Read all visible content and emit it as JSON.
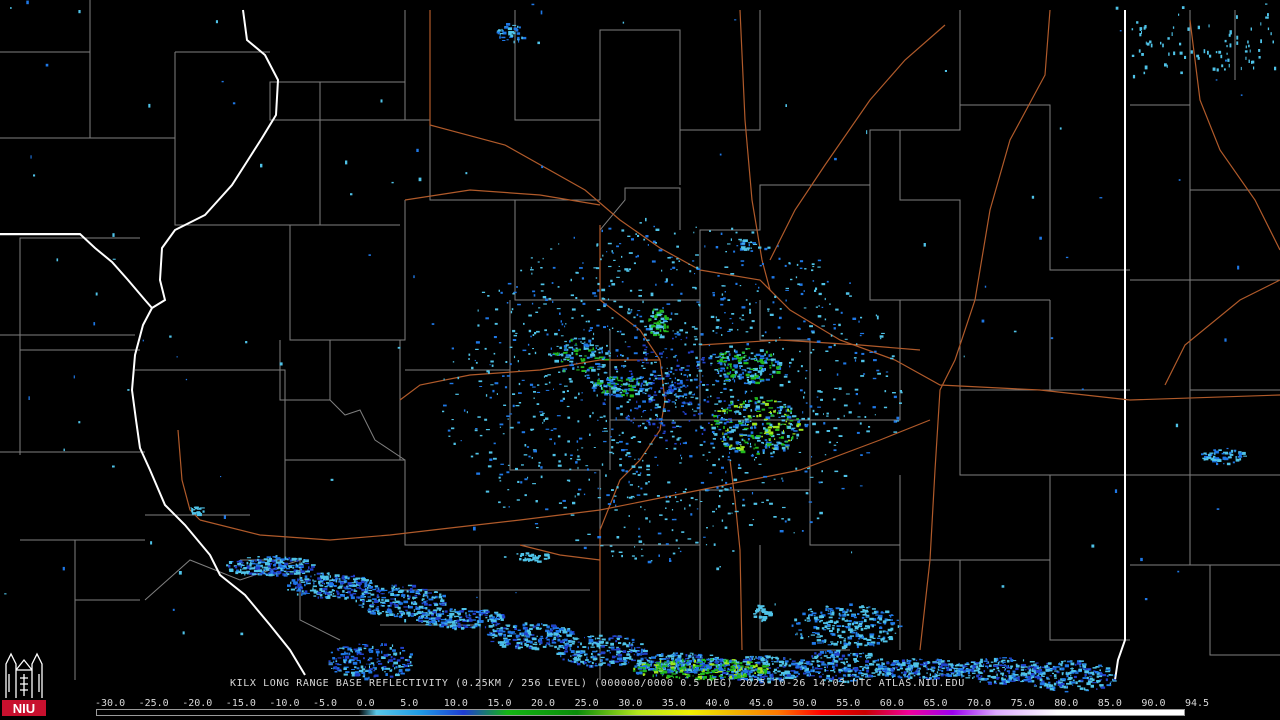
{
  "product": {
    "caption": "KILX LONG RANGE BASE REFLECTIVITY (0.25KM / 256 LEVEL) (000000/0000 0.5 DEG) 2025-10-26 14:02 UTC  ATLAS.NIU.EDU"
  },
  "logo": {
    "text": "NIU",
    "colors": {
      "red": "#c8102e",
      "white": "#ffffff"
    }
  },
  "colorbar": {
    "labels": [
      "-30.0",
      "-25.0",
      "-20.0",
      "-15.0",
      "-10.0",
      "-5.0",
      "0.0",
      "5.0",
      "10.0",
      "15.0",
      "20.0",
      "25.0",
      "30.0",
      "35.0",
      "40.0",
      "45.0",
      "50.0",
      "55.0",
      "60.0",
      "65.0",
      "70.0",
      "75.0",
      "80.0",
      "85.0",
      "90.0",
      "94.5"
    ],
    "stops": [
      {
        "dbz": -30,
        "color": "#000000"
      },
      {
        "dbz": 0,
        "color": "#000000"
      },
      {
        "dbz": 2,
        "color": "#58c8e8"
      },
      {
        "dbz": 7,
        "color": "#1e9be6"
      },
      {
        "dbz": 12,
        "color": "#1e3cd2"
      },
      {
        "dbz": 17,
        "color": "#14b414"
      },
      {
        "dbz": 25,
        "color": "#0a8c0a"
      },
      {
        "dbz": 32,
        "color": "#b4e61e"
      },
      {
        "dbz": 38,
        "color": "#f0f000"
      },
      {
        "dbz": 43,
        "color": "#f0b400"
      },
      {
        "dbz": 48,
        "color": "#ff7800"
      },
      {
        "dbz": 53,
        "color": "#ff0000"
      },
      {
        "dbz": 58,
        "color": "#c80000"
      },
      {
        "dbz": 63,
        "color": "#f0009b"
      },
      {
        "dbz": 68,
        "color": "#9b00f0"
      },
      {
        "dbz": 73,
        "color": "#dcaaff"
      },
      {
        "dbz": 80,
        "color": "#ffffff"
      },
      {
        "dbz": 94.5,
        "color": "#ffffff"
      }
    ]
  },
  "colors": {
    "background": "#000000",
    "county_lines": "#7f7f7f",
    "state_lines": "#ffffff",
    "highways": "#b05a2a",
    "radar_light": "#4fc3e8",
    "radar_blue": "#1f78e6",
    "radar_deep": "#2140c8",
    "radar_green": "#22b81e",
    "radar_lime": "#9ee61e",
    "radar_yellow": "#e8e020"
  }
}
